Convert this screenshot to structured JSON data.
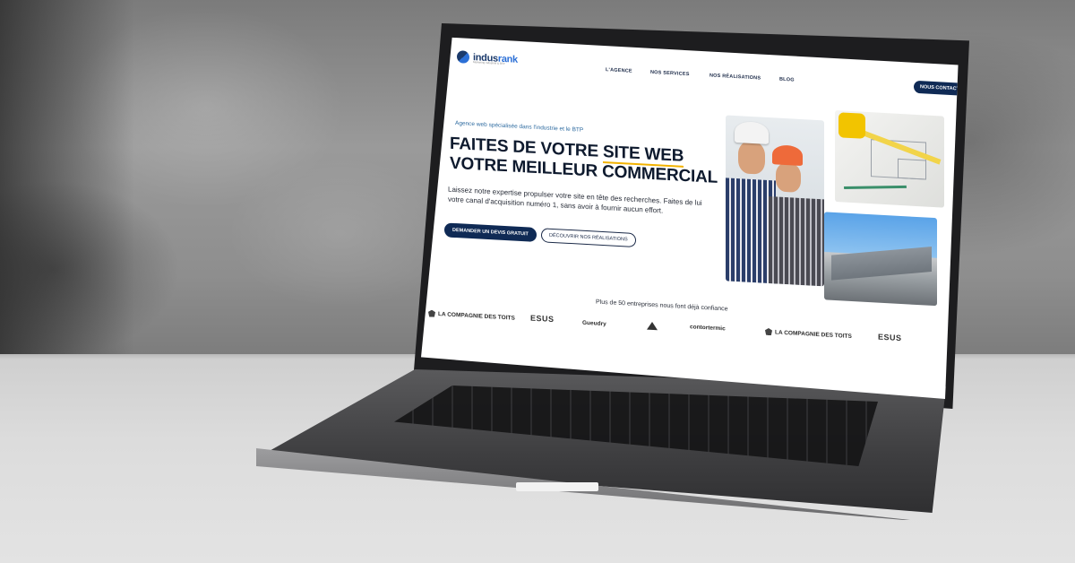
{
  "nav": {
    "logo_main": "indus",
    "logo_accent": "rank",
    "logo_tagline": "Marketing Industriel & BTP",
    "items": [
      "L'AGENCE",
      "NOS SERVICES",
      "NOS RÉALISATIONS",
      "BLOG"
    ],
    "cta": "NOUS CONTACTER"
  },
  "hero": {
    "kicker": "Agence web spécialisée dans l'industrie et le BTP",
    "title_line1_prefix": "FAITES DE VOTRE ",
    "title_line1_highlight": "SITE WEB",
    "title_line2": "VOTRE MEILLEUR COMMERCIAL",
    "text": "Laissez notre expertise propulser votre site en tête des recherches. Faites de lui votre canal d'acquisition numéro 1, sans avoir à fournir aucun effort.",
    "primary_button": "DEMANDER UN DEVIS GRATUIT",
    "secondary_button": "DÉCOUVRIR NOS RÉALISATIONS"
  },
  "trust": {
    "title": "Plus de 50 entreprises nous font déjà confiance",
    "logos": [
      "LA COMPAGNIE DES TOITS",
      "ESUS",
      "Gueudry",
      "contortermic",
      "LA COMPAGNIE DES TOITS",
      "ESUS"
    ]
  },
  "colors": {
    "navy": "#0f2a55",
    "highlight": "#f2b200",
    "kicker": "#2e6ba0"
  }
}
